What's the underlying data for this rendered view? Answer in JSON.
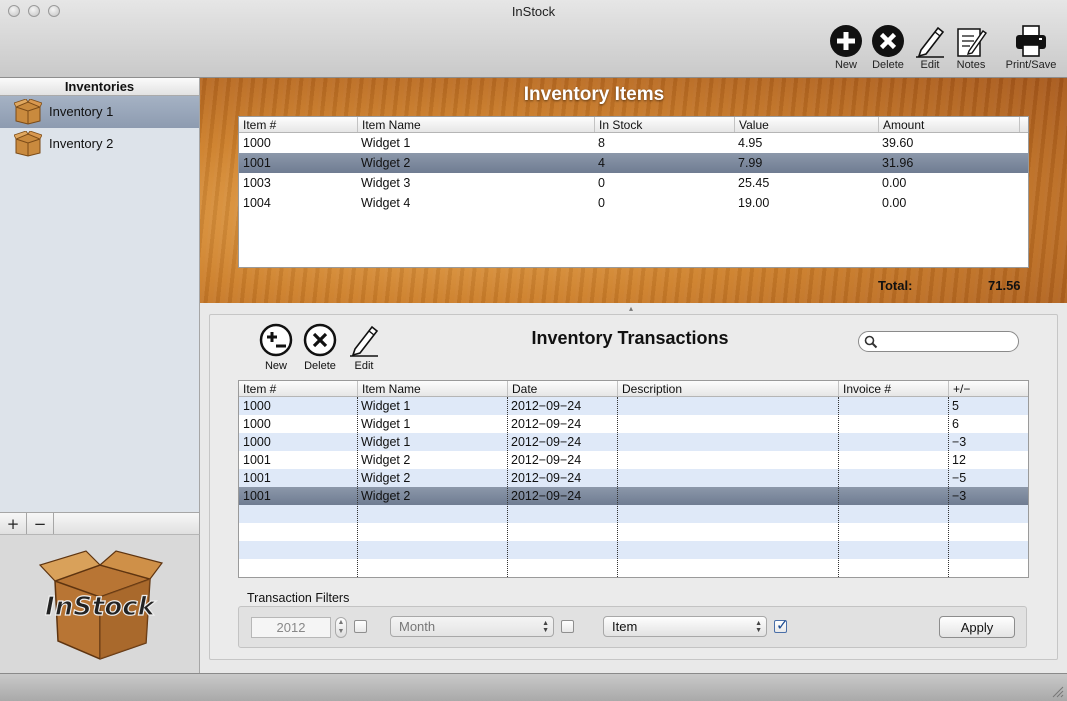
{
  "window": {
    "title": "InStock"
  },
  "toolbar": {
    "new_label": "New",
    "delete_label": "Delete",
    "edit_label": "Edit",
    "notes_label": "Notes",
    "print_label": "Print/Save"
  },
  "sidebar": {
    "header": "Inventories",
    "items": [
      {
        "label": "Inventory 1",
        "selected": true
      },
      {
        "label": "Inventory 2",
        "selected": false
      }
    ],
    "add_label": "+",
    "remove_label": "−",
    "logo_text": "InStock"
  },
  "items_panel": {
    "title": "Inventory Items",
    "columns": [
      "Item #",
      "Item Name",
      "In Stock",
      "Value",
      "Amount"
    ],
    "rows": [
      [
        "1000",
        "Widget 1",
        "8",
        "4.95",
        "39.60"
      ],
      [
        "1001",
        "Widget 2",
        "4",
        "7.99",
        "31.96"
      ],
      [
        "1003",
        "Widget 3",
        "0",
        "25.45",
        "0.00"
      ],
      [
        "1004",
        "Widget 4",
        "0",
        "19.00",
        "0.00"
      ]
    ],
    "selected_row": 1,
    "total_label": "Total:",
    "total_value": "71.56"
  },
  "transactions": {
    "title": "Inventory Transactions",
    "new_label": "New",
    "delete_label": "Delete",
    "edit_label": "Edit",
    "search_placeholder": "",
    "columns": [
      "Item #",
      "Item Name",
      "Date",
      "Description",
      "Invoice #",
      "+/−"
    ],
    "rows": [
      [
        "1000",
        "Widget 1",
        "2012−09−24",
        "",
        "",
        "5"
      ],
      [
        "1000",
        "Widget 1",
        "2012−09−24",
        "",
        "",
        "6"
      ],
      [
        "1000",
        "Widget 1",
        "2012−09−24",
        "",
        "",
        "−3"
      ],
      [
        "1001",
        "Widget 2",
        "2012−09−24",
        "",
        "",
        "12"
      ],
      [
        "1001",
        "Widget 2",
        "2012−09−24",
        "",
        "",
        "−5"
      ],
      [
        "1001",
        "Widget 2",
        "2012−09−24",
        "",
        "",
        "−3"
      ]
    ],
    "selected_row": 5
  },
  "filters": {
    "label": "Transaction Filters",
    "year_value": "2012",
    "year_checked": false,
    "month_value": "Month",
    "month_checked": false,
    "item_value": "Item",
    "item_checked": true,
    "apply_label": "Apply"
  }
}
